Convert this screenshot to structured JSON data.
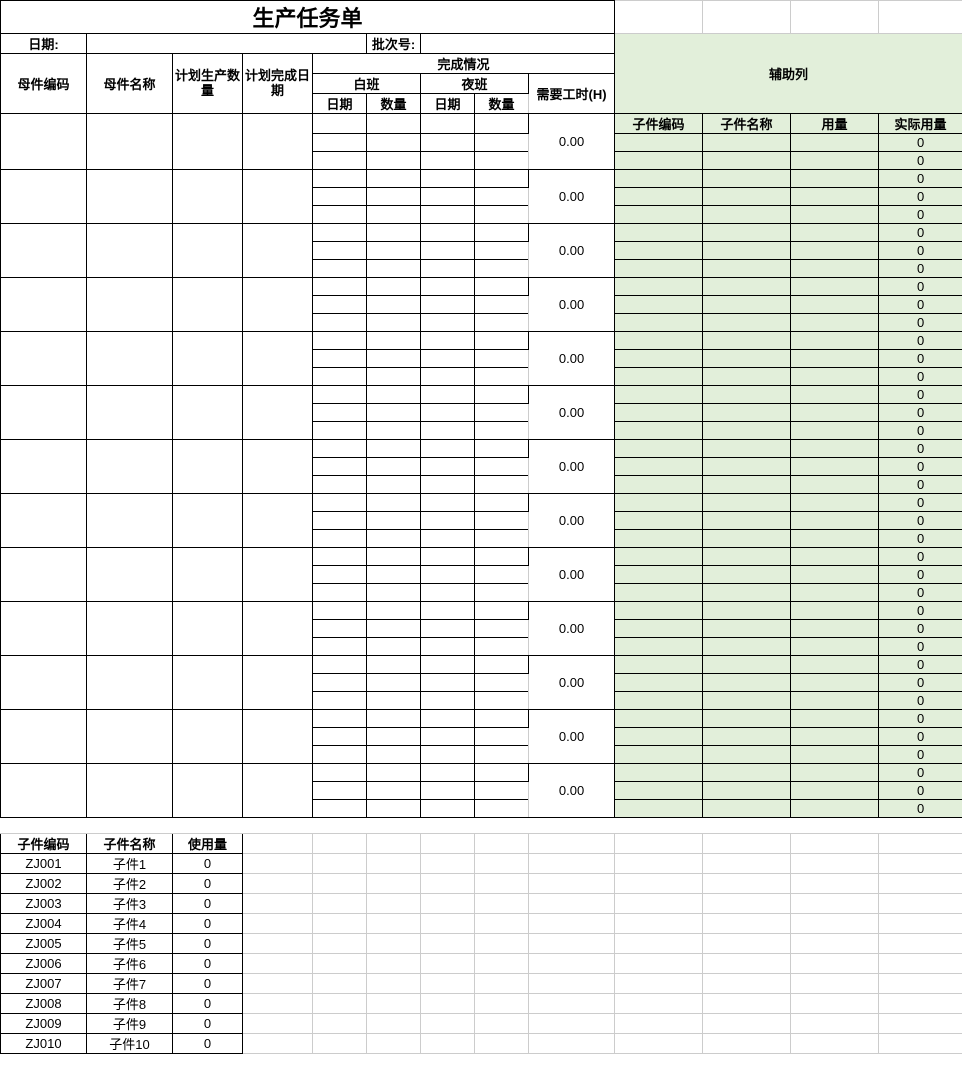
{
  "title": "生产任务单",
  "labels": {
    "date": "日期:",
    "batch": "批次号:",
    "parentCode": "母件编码",
    "parentName": "母件名称",
    "planQty": "计划生产数量",
    "planDate": "计划完成日期",
    "completion": "完成情况",
    "dayShift": "白班",
    "nightShift": "夜班",
    "shiftDate": "日期",
    "shiftQty": "数量",
    "workHours": "需要工时(H)",
    "auxCol": "辅助列",
    "childCode": "子件编码",
    "childName": "子件名称",
    "usage": "用量",
    "actualUsage": "实际用量",
    "usageAmount": "使用量"
  },
  "workHoursValue": "0.00",
  "actualUsageValue": "0",
  "childList": [
    {
      "code": "ZJ001",
      "name": "子件1",
      "usage": "0"
    },
    {
      "code": "ZJ002",
      "name": "子件2",
      "usage": "0"
    },
    {
      "code": "ZJ003",
      "name": "子件3",
      "usage": "0"
    },
    {
      "code": "ZJ004",
      "name": "子件4",
      "usage": "0"
    },
    {
      "code": "ZJ005",
      "name": "子件5",
      "usage": "0"
    },
    {
      "code": "ZJ006",
      "name": "子件6",
      "usage": "0"
    },
    {
      "code": "ZJ007",
      "name": "子件7",
      "usage": "0"
    },
    {
      "code": "ZJ008",
      "name": "子件8",
      "usage": "0"
    },
    {
      "code": "ZJ009",
      "name": "子件9",
      "usage": "0"
    },
    {
      "code": "ZJ010",
      "name": "子件10",
      "usage": "0"
    }
  ]
}
